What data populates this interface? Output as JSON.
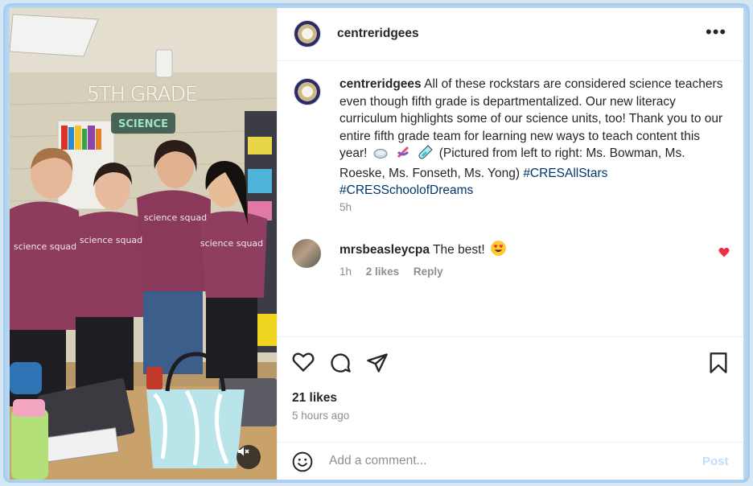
{
  "photo": {
    "heading": "5TH GRADE",
    "shirt_text": "science squad",
    "sign_text": "SCIENCE"
  },
  "header": {
    "username": "centreridgees",
    "more_icon": "more-horizontal-icon"
  },
  "caption": {
    "username": "centreridgees",
    "text_1": "All of these rockstars are considered science teachers even though fifth grade is departmentalized. Our new literacy curriculum highlights some of our science units, too! Thank you to our entire fifth grade team for learning new ways to teach content this year!",
    "emojis": [
      "petri-dish-icon",
      "dna-icon",
      "test-tube-icon"
    ],
    "text_2": "(Pictured from left to right: Ms. Bowman, Ms. Roeske, Ms. Fonseth, Ms. Yong)",
    "hashtag_1": "#CRESAllStars",
    "hashtag_2": "#CRESSchoolofDreams",
    "time": "5h"
  },
  "comment": {
    "username": "mrsbeasleycpa",
    "text": "The best!",
    "emoji": "heart-eyes-icon",
    "time": "1h",
    "likes": "2 likes",
    "reply": "Reply",
    "liked": true
  },
  "actions": {
    "likes": "21 likes",
    "posted": "5 hours ago"
  },
  "add_comment": {
    "placeholder": "Add a comment...",
    "post_label": "Post"
  },
  "colors": {
    "link": "#00376b",
    "muted": "#8e8e8e",
    "like_red": "#ed2f42",
    "post_disabled": "#c0dffd"
  }
}
